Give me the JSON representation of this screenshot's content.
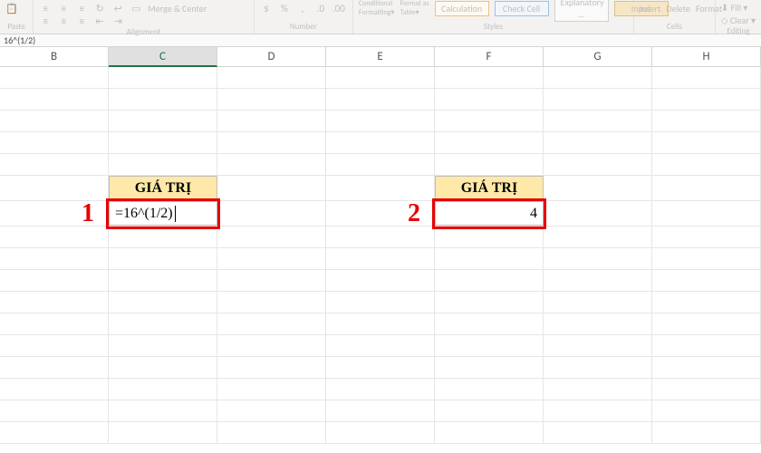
{
  "ribbon": {
    "clipboard": {
      "paste": "Paste"
    },
    "alignment": {
      "merge": "Merge & Center",
      "label": "Alignment"
    },
    "number": {
      "label": "Number"
    },
    "styles": {
      "conditional": "Conditional\nFormatting",
      "format_table": "Format as\nTable",
      "calc": "Calculation",
      "check": "Check Cell",
      "explanatory": "Explanatory ...",
      "input": "Input",
      "label": "Styles"
    },
    "cells": {
      "insert": "Insert",
      "delete": "Delete",
      "format": "Format",
      "label": "Cells"
    },
    "editing": {
      "fill": "Fill",
      "clear": "Clear",
      "label": "Editing"
    }
  },
  "formula_bar": {
    "content": "16^(1/2)"
  },
  "columns": [
    "B",
    "C",
    "D",
    "E",
    "F",
    "G",
    "H"
  ],
  "active_column": "C",
  "annotations": {
    "label1": "1",
    "label2": "2",
    "header1": "GIÁ TRỊ",
    "header2": "GIÁ TRỊ",
    "formula": "=16^(1/2)",
    "result": "4"
  }
}
